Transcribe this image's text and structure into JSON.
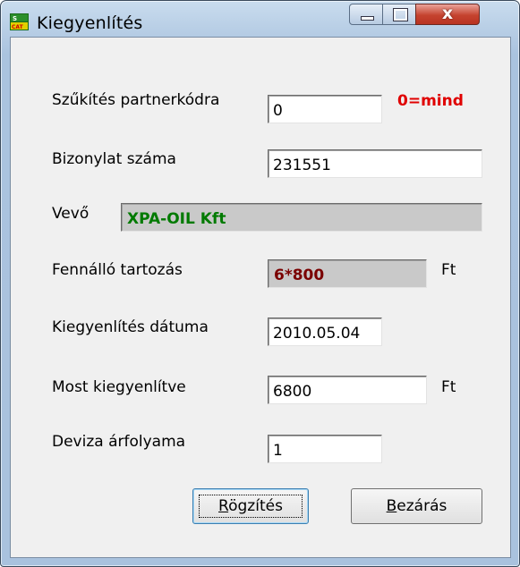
{
  "window": {
    "title": "Kiegyenlítés",
    "close_glyph": "x",
    "icon": "app-logo-icon"
  },
  "form": {
    "partner_label": "Szűkítés partnerkódra",
    "partner_value": "0",
    "partner_hint": "0=mind",
    "doc_label": "Bizonylat száma",
    "doc_value": "231551",
    "customer_label": "Vevő",
    "customer_value": "XPA-OIL Kft",
    "debt_label": "Fennálló tartozás",
    "debt_value": "6*800",
    "debt_unit": "Ft",
    "date_label": "Kiegyenlítés dátuma",
    "date_value": "2010.05.04",
    "paid_label": "Most kiegyenlítve",
    "paid_value": "6800",
    "paid_unit": "Ft",
    "rate_label": "Deviza árfolyama",
    "rate_value": "1"
  },
  "buttons": {
    "save_rest": "ögzítés",
    "save_mnemonic": "R",
    "close_rest": "ezárás",
    "close_mnemonic": "B"
  },
  "colors": {
    "hint": "#e00000",
    "customer": "#007a00",
    "debt": "#7a0000"
  }
}
